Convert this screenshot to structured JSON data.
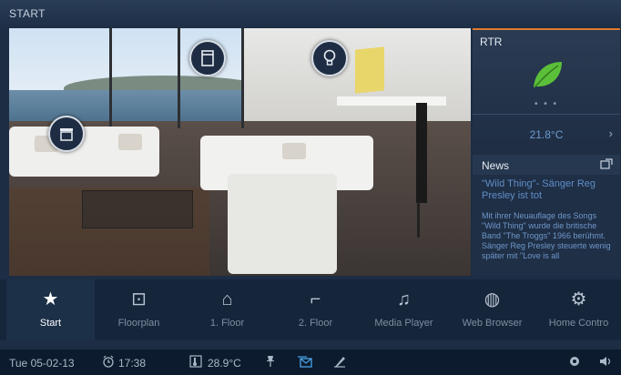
{
  "header": {
    "title": "START"
  },
  "scene": {
    "hotspots": [
      {
        "name": "blinds-icon"
      },
      {
        "name": "window-icon"
      },
      {
        "name": "light-bulb-icon"
      }
    ]
  },
  "rtr": {
    "label": "RTR",
    "dots": "• • •",
    "temperature": "21.8°C",
    "chevron": "›",
    "accent": "#e07a2f",
    "leaf_color": "#5bbf3a"
  },
  "news": {
    "label": "News",
    "headline": "\"Wild Thing\"- Sänger Reg Presley ist tot",
    "body": "Mit ihrer Neuauflage des Songs \"Wild Thing\" wurde die britische Band \"The Troggs\" 1966 berühmt. Sänger Reg Presley steuerte wenig später mit \"Love is all"
  },
  "nav": {
    "items": [
      {
        "label": "Start",
        "icon": "star-icon",
        "glyph": "★"
      },
      {
        "label": "Floorplan",
        "icon": "floorplan-icon",
        "glyph": "⊡"
      },
      {
        "label": "1. Floor",
        "icon": "house-icon",
        "glyph": "⌂"
      },
      {
        "label": "2. Floor",
        "icon": "stairs-icon",
        "glyph": "⌐"
      },
      {
        "label": "Media Player",
        "icon": "media-player-icon",
        "glyph": "♫"
      },
      {
        "label": "Web Browser",
        "icon": "globe-icon",
        "glyph": "◍"
      },
      {
        "label": "Home Contro",
        "icon": "gear-calendar-icon",
        "glyph": "⚙"
      }
    ]
  },
  "status": {
    "date": "Tue 05-02-13",
    "alarm_time": "17:38",
    "outside_temp": "28.9°C"
  }
}
